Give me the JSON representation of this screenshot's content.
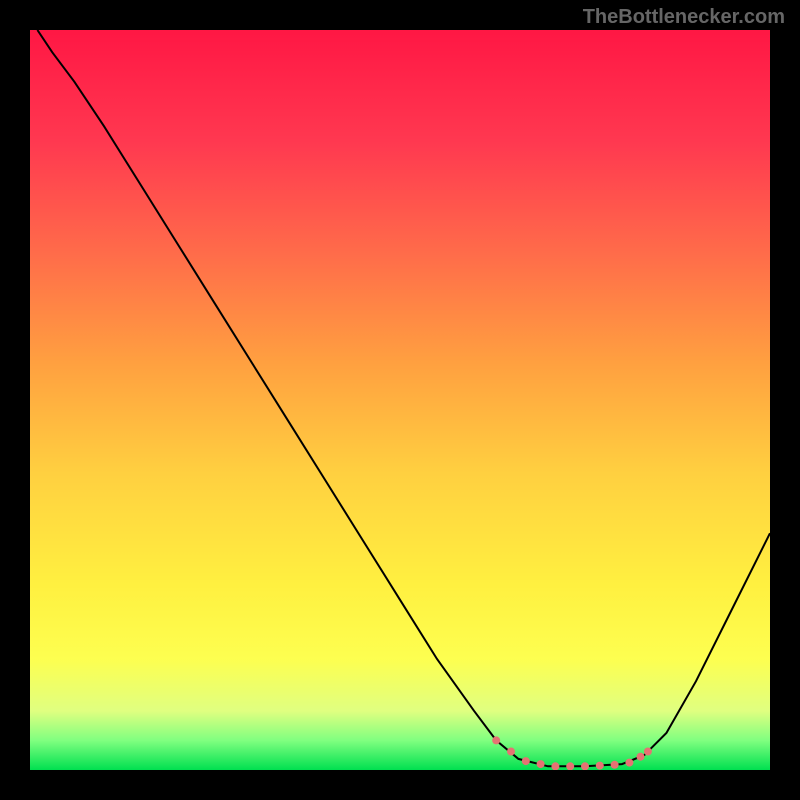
{
  "watermark": "TheBottlenecker.com",
  "chart_data": {
    "type": "line",
    "title": "",
    "xlabel": "",
    "ylabel": "",
    "xlim": [
      0,
      100
    ],
    "ylim": [
      0,
      100
    ],
    "background_gradient": {
      "type": "vertical",
      "stops": [
        {
          "pos": 0,
          "color": "#ff1744"
        },
        {
          "pos": 0.15,
          "color": "#ff3850"
        },
        {
          "pos": 0.3,
          "color": "#ff6b4a"
        },
        {
          "pos": 0.45,
          "color": "#ffa040"
        },
        {
          "pos": 0.6,
          "color": "#ffd040"
        },
        {
          "pos": 0.75,
          "color": "#fff040"
        },
        {
          "pos": 0.85,
          "color": "#fdff50"
        },
        {
          "pos": 0.92,
          "color": "#e0ff80"
        },
        {
          "pos": 0.96,
          "color": "#80ff80"
        },
        {
          "pos": 1,
          "color": "#00e050"
        }
      ]
    },
    "curve": {
      "color": "#000000",
      "width": 2,
      "points": [
        {
          "x": 1,
          "y": 100
        },
        {
          "x": 3,
          "y": 97
        },
        {
          "x": 6,
          "y": 93
        },
        {
          "x": 10,
          "y": 87
        },
        {
          "x": 15,
          "y": 79
        },
        {
          "x": 20,
          "y": 71
        },
        {
          "x": 25,
          "y": 63
        },
        {
          "x": 30,
          "y": 55
        },
        {
          "x": 35,
          "y": 47
        },
        {
          "x": 40,
          "y": 39
        },
        {
          "x": 45,
          "y": 31
        },
        {
          "x": 50,
          "y": 23
        },
        {
          "x": 55,
          "y": 15
        },
        {
          "x": 60,
          "y": 8
        },
        {
          "x": 63,
          "y": 4
        },
        {
          "x": 66,
          "y": 1.5
        },
        {
          "x": 70,
          "y": 0.5
        },
        {
          "x": 75,
          "y": 0.5
        },
        {
          "x": 80,
          "y": 0.8
        },
        {
          "x": 83,
          "y": 2
        },
        {
          "x": 86,
          "y": 5
        },
        {
          "x": 90,
          "y": 12
        },
        {
          "x": 94,
          "y": 20
        },
        {
          "x": 98,
          "y": 28
        },
        {
          "x": 100,
          "y": 32
        }
      ]
    },
    "markers": {
      "color": "#e57373",
      "radius": 4,
      "points": [
        {
          "x": 63,
          "y": 4
        },
        {
          "x": 65,
          "y": 2.5
        },
        {
          "x": 67,
          "y": 1.2
        },
        {
          "x": 69,
          "y": 0.8
        },
        {
          "x": 71,
          "y": 0.5
        },
        {
          "x": 73,
          "y": 0.5
        },
        {
          "x": 75,
          "y": 0.5
        },
        {
          "x": 77,
          "y": 0.6
        },
        {
          "x": 79,
          "y": 0.7
        },
        {
          "x": 81,
          "y": 1
        },
        {
          "x": 82.5,
          "y": 1.8
        },
        {
          "x": 83.5,
          "y": 2.5
        }
      ]
    }
  }
}
